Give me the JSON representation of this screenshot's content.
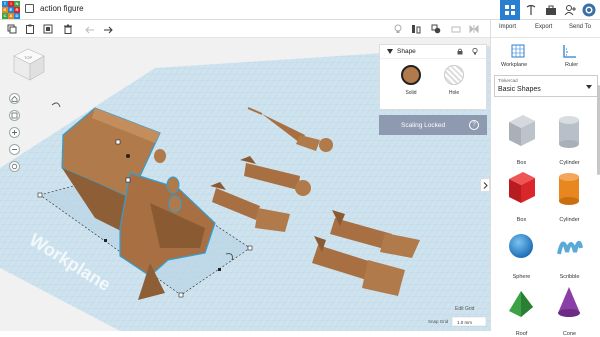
{
  "app": {
    "logo_letters": [
      "T",
      "I",
      "N",
      "K",
      "E",
      "R",
      "C",
      "A",
      "D"
    ],
    "document_title": "action figure"
  },
  "right_panel": {
    "import_label": "Import",
    "export_label": "Export",
    "send_to_label": "Send To",
    "workplane_label": "Workplane",
    "ruler_label": "Ruler",
    "library_group": "Tinkercad",
    "library_selected": "Basic Shapes",
    "shapes": [
      {
        "label": "Box",
        "color": "#b8bfc8"
      },
      {
        "label": "Cylinder",
        "color": "#b8bfc8"
      },
      {
        "label": "Box",
        "color": "#d9262a"
      },
      {
        "label": "Cylinder",
        "color": "#e8871e"
      },
      {
        "label": "Sphere",
        "color": "#1e88d8"
      },
      {
        "label": "Scribble",
        "color": "#5aaad8"
      },
      {
        "label": "Roof",
        "color": "#3ba245"
      },
      {
        "label": "Cone",
        "color": "#8a3fa8"
      }
    ]
  },
  "shape_panel": {
    "title": "Shape",
    "solid_label": "Solid",
    "hole_label": "Hole",
    "solid_color": "#b07a4a"
  },
  "scaling_banner": {
    "label": "Scaling Locked",
    "help": "?"
  },
  "canvas": {
    "workplane_text": "Workplane",
    "view_cube_label": "TOP",
    "edit_grid_label": "Edit Grid",
    "snap_grid_label": "Snap Grid",
    "snap_grid_value": "1.0 mm"
  },
  "colors": {
    "accent": "#2a7fd0",
    "grid_bg": "#cfe3ef",
    "model": "#b07a4a"
  }
}
